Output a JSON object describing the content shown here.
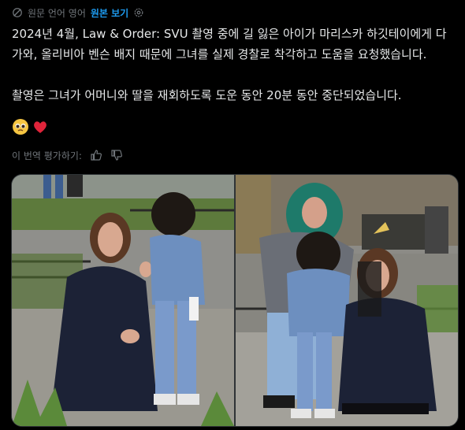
{
  "translation": {
    "label": "원문 언어 영어",
    "show_original": "원본 보기"
  },
  "post": {
    "paragraph1": "2024년 4월, Law & Order: SVU 촬영 중에 길 잃은 아이가 마리스카 하깃테이에게 다가와, 올리비아 벤슨 배지 때문에 그녀를 실제 경찰로 착각하고 도움을 요청했습니다.",
    "paragraph2": "촬영은 그녀가 어머니와 딸을 재회하도록 도운 동안 20분 동안 중단되었습니다.",
    "emojis": [
      "🥹",
      "❤️"
    ]
  },
  "rating": {
    "label": "이 번역 평가하기:"
  },
  "media": {
    "photos": [
      {
        "name": "photo-left"
      },
      {
        "name": "photo-right"
      }
    ]
  },
  "colors": {
    "background": "#000000",
    "text": "#e7e9ea",
    "muted": "#71767b",
    "accent": "#1d9bf0"
  }
}
